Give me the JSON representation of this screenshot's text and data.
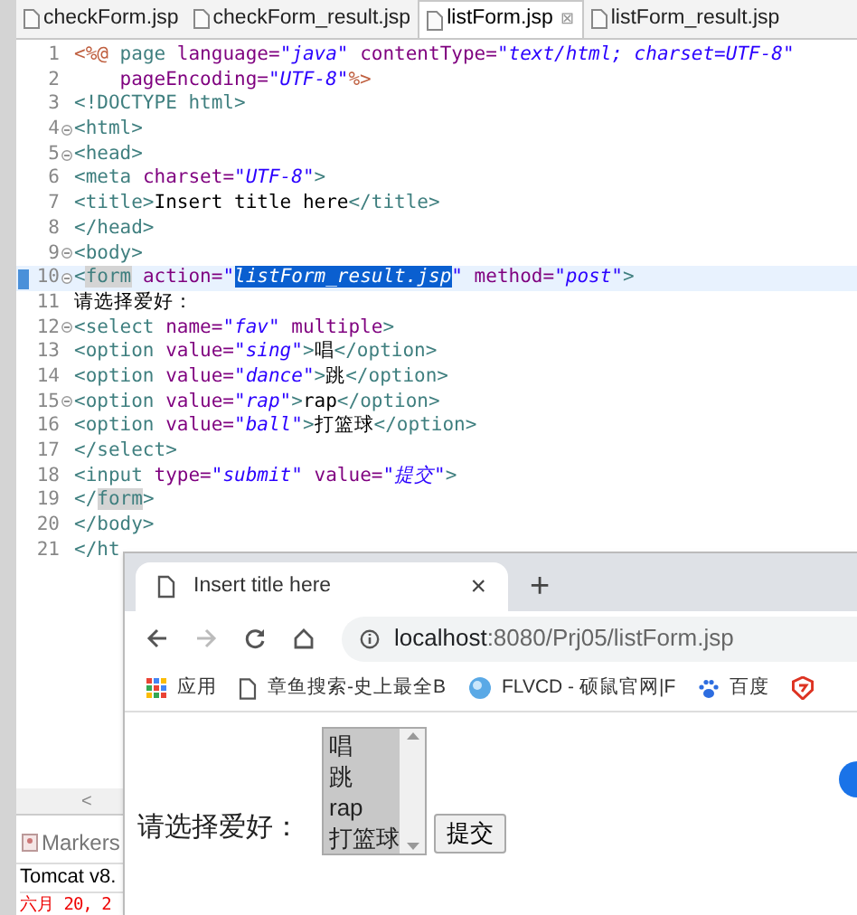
{
  "editor": {
    "tabs": [
      {
        "label": "checkForm.jsp",
        "selected": false
      },
      {
        "label": "checkForm_result.jsp",
        "selected": false
      },
      {
        "label": "listForm.jsp",
        "selected": true,
        "close": "⊠"
      },
      {
        "label": "listForm_result.jsp",
        "selected": false
      }
    ],
    "lines": [
      {
        "number": "1",
        "fold": false,
        "current": false,
        "tokens": [
          {
            "kind": "directive",
            "text": "<%@ "
          },
          {
            "kind": "tag",
            "text": "page "
          },
          {
            "kind": "attr",
            "text": "language="
          },
          {
            "kind": "string",
            "text": "\"java\" "
          },
          {
            "kind": "attr",
            "text": "contentType="
          },
          {
            "kind": "string",
            "text": "\"text/html; charset=UTF-8\""
          }
        ]
      },
      {
        "number": "2",
        "fold": false,
        "current": false,
        "tokens": [
          {
            "kind": "attr",
            "text": "    pageEncoding="
          },
          {
            "kind": "string",
            "text": "\"UTF-8\""
          },
          {
            "kind": "directive",
            "text": "%>"
          }
        ]
      },
      {
        "number": "3",
        "fold": false,
        "current": false,
        "tokens": [
          {
            "kind": "tag",
            "text": "<!DOCTYPE html>"
          }
        ]
      },
      {
        "number": "4",
        "fold": true,
        "current": false,
        "tokens": [
          {
            "kind": "tag",
            "text": "<html>"
          }
        ]
      },
      {
        "number": "5",
        "fold": true,
        "current": false,
        "tokens": [
          {
            "kind": "tag",
            "text": "<head>"
          }
        ]
      },
      {
        "number": "6",
        "fold": false,
        "current": false,
        "tokens": [
          {
            "kind": "tag",
            "text": "<meta "
          },
          {
            "kind": "attr",
            "text": "charset="
          },
          {
            "kind": "string",
            "text": "\"UTF-8\""
          },
          {
            "kind": "tag",
            "text": ">"
          }
        ]
      },
      {
        "number": "7",
        "fold": false,
        "current": false,
        "tokens": [
          {
            "kind": "tag",
            "text": "<title>"
          },
          {
            "kind": "text",
            "text": "Insert title here"
          },
          {
            "kind": "tag",
            "text": "</title>"
          }
        ]
      },
      {
        "number": "8",
        "fold": false,
        "current": false,
        "tokens": [
          {
            "kind": "tag",
            "text": "</head>"
          }
        ]
      },
      {
        "number": "9",
        "fold": true,
        "current": false,
        "tokens": [
          {
            "kind": "tag",
            "text": "<body>"
          }
        ]
      },
      {
        "number": "10",
        "fold": true,
        "current": true,
        "tokens": [
          {
            "kind": "tag",
            "text": "<"
          },
          {
            "kind": "tag_occurrence",
            "text": "form"
          },
          {
            "kind": "attr",
            "text": " action="
          },
          {
            "kind": "string",
            "text": "\""
          },
          {
            "kind": "string_selection",
            "text": "listForm_result.jsp"
          },
          {
            "kind": "string",
            "text": "\" "
          },
          {
            "kind": "attr",
            "text": "method="
          },
          {
            "kind": "string",
            "text": "\"post\""
          },
          {
            "kind": "tag",
            "text": ">"
          }
        ]
      },
      {
        "number": "11",
        "fold": false,
        "current": false,
        "tokens": [
          {
            "kind": "text",
            "text": "请选择爱好："
          }
        ]
      },
      {
        "number": "12",
        "fold": true,
        "current": false,
        "tokens": [
          {
            "kind": "tag",
            "text": "<select "
          },
          {
            "kind": "attr",
            "text": "name="
          },
          {
            "kind": "string",
            "text": "\"fav\" "
          },
          {
            "kind": "attr",
            "text": "multiple"
          },
          {
            "kind": "tag",
            "text": ">"
          }
        ]
      },
      {
        "number": "13",
        "fold": false,
        "current": false,
        "tokens": [
          {
            "kind": "tag",
            "text": "<option "
          },
          {
            "kind": "attr",
            "text": "value="
          },
          {
            "kind": "string",
            "text": "\"sing\""
          },
          {
            "kind": "tag",
            "text": ">"
          },
          {
            "kind": "text",
            "text": "唱"
          },
          {
            "kind": "tag",
            "text": "</option>"
          }
        ]
      },
      {
        "number": "14",
        "fold": false,
        "current": false,
        "tokens": [
          {
            "kind": "tag",
            "text": "<option "
          },
          {
            "kind": "attr",
            "text": "value="
          },
          {
            "kind": "string",
            "text": "\"dance\""
          },
          {
            "kind": "tag",
            "text": ">"
          },
          {
            "kind": "text",
            "text": "跳"
          },
          {
            "kind": "tag",
            "text": "</option>"
          }
        ]
      },
      {
        "number": "15",
        "fold": true,
        "current": false,
        "tokens": [
          {
            "kind": "tag",
            "text": "<option "
          },
          {
            "kind": "attr",
            "text": "value="
          },
          {
            "kind": "string",
            "text": "\"rap\""
          },
          {
            "kind": "tag",
            "text": ">"
          },
          {
            "kind": "text",
            "text": "rap"
          },
          {
            "kind": "tag",
            "text": "</option>"
          }
        ]
      },
      {
        "number": "16",
        "fold": false,
        "current": false,
        "tokens": [
          {
            "kind": "tag",
            "text": "<option "
          },
          {
            "kind": "attr",
            "text": "value="
          },
          {
            "kind": "string",
            "text": "\"ball\""
          },
          {
            "kind": "tag",
            "text": ">"
          },
          {
            "kind": "text",
            "text": "打篮球"
          },
          {
            "kind": "tag",
            "text": "</option>"
          }
        ]
      },
      {
        "number": "17",
        "fold": false,
        "current": false,
        "tokens": [
          {
            "kind": "tag",
            "text": "</select>"
          }
        ]
      },
      {
        "number": "18",
        "fold": false,
        "current": false,
        "tokens": [
          {
            "kind": "tag",
            "text": "<input "
          },
          {
            "kind": "attr",
            "text": "type="
          },
          {
            "kind": "string",
            "text": "\"submit\" "
          },
          {
            "kind": "attr",
            "text": "value="
          },
          {
            "kind": "string",
            "text": "\"提交\""
          },
          {
            "kind": "tag",
            "text": ">"
          }
        ]
      },
      {
        "number": "19",
        "fold": false,
        "current": false,
        "tokens": [
          {
            "kind": "tag",
            "text": "</"
          },
          {
            "kind": "tag_occurrence",
            "text": "form"
          },
          {
            "kind": "tag",
            "text": ">"
          }
        ]
      },
      {
        "number": "20",
        "fold": false,
        "current": false,
        "tokens": [
          {
            "kind": "tag",
            "text": "</body>"
          }
        ]
      },
      {
        "number": "21",
        "fold": false,
        "current": false,
        "tokens": [
          {
            "kind": "tag",
            "text": "</ht"
          }
        ]
      }
    ]
  },
  "bottom_panel": {
    "scroll_arrow": "<",
    "tab": "Markers",
    "rows": [
      {
        "kind": "normal",
        "text": "Tomcat v8."
      },
      {
        "kind": "error",
        "text": "六月 20, 2"
      }
    ]
  },
  "browser": {
    "tab": {
      "title": "Insert title here",
      "close": "×"
    },
    "new_tab": "+",
    "forward_enabled": false,
    "address": {
      "host": "localhost",
      "path": ":8080/Prj05/listForm.jsp"
    },
    "bookmarks": [
      {
        "kind": "apps",
        "label": "应用"
      },
      {
        "kind": "page",
        "label": "章鱼搜索-史上最全B"
      },
      {
        "kind": "globe",
        "label": "FLVCD - 硕鼠官网|F"
      },
      {
        "kind": "paw",
        "label": "百度"
      },
      {
        "kind": "logo"
      }
    ],
    "form": {
      "label": "请选择爱好：",
      "options": [
        {
          "text": "唱",
          "selected": true
        },
        {
          "text": "跳",
          "selected": true
        },
        {
          "text": "rap",
          "selected": true
        },
        {
          "text": "打篮球",
          "selected": true
        }
      ],
      "submit": "提交"
    }
  }
}
